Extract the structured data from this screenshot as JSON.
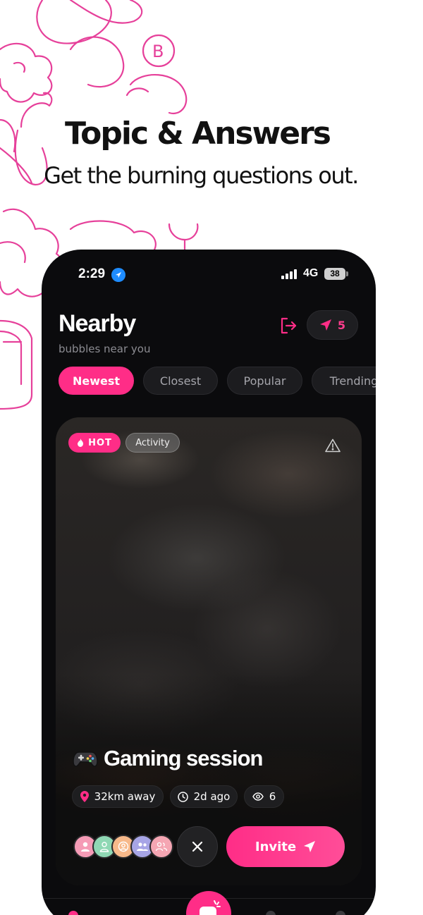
{
  "promo": {
    "headline": "Topic & Answers",
    "subline": "Get the burning questions out."
  },
  "status_bar": {
    "time": "2:29",
    "network": "4G",
    "battery": "38"
  },
  "header": {
    "title": "Nearby",
    "subtitle": "bubbles near you",
    "send_count": "5"
  },
  "tabs": [
    {
      "label": "Newest",
      "active": true
    },
    {
      "label": "Closest",
      "active": false
    },
    {
      "label": "Popular",
      "active": false
    },
    {
      "label": "Trending",
      "active": false
    }
  ],
  "card": {
    "hot_label": "HOT",
    "category_label": "Activity",
    "title": "Gaming session",
    "title_emoji": "gamepad-icon",
    "distance": "32km away",
    "time_ago": "2d ago",
    "views": "6",
    "invite_label": "Invite"
  },
  "colors": {
    "accent": "#ff2d87",
    "background": "#0b0b0d",
    "doodle": "#e6409a"
  }
}
